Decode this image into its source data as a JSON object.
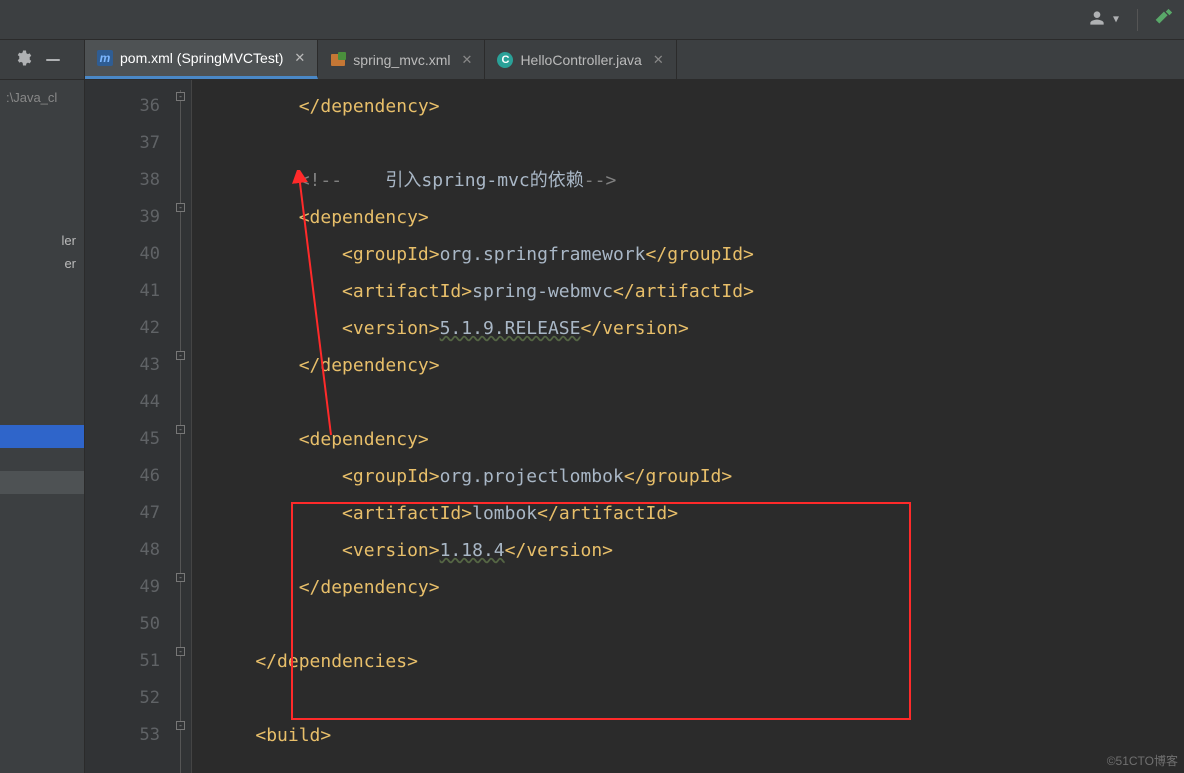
{
  "topbar": {},
  "sidebar": {
    "path": ":\\Java_cl",
    "item1": "ler",
    "item2": "er"
  },
  "tabs": {
    "t1": "pom.xml (SpringMVCTest)",
    "t2": "spring_mvc.xml",
    "t3": "HelloController.java"
  },
  "gutter": [
    "36",
    "37",
    "38",
    "39",
    "40",
    "41",
    "42",
    "43",
    "44",
    "45",
    "46",
    "47",
    "48",
    "49",
    "50",
    "51",
    "52",
    "53"
  ],
  "code": {
    "l36a": "        </",
    "l36b": "dependency",
    "l36c": ">",
    "l37": "",
    "l38a": "        <!--    ",
    "l38b": "引入spring-mvc的依赖",
    "l38c": "-->",
    "l39a": "        <",
    "l39b": "dependency",
    "l39c": ">",
    "l40a": "            <",
    "l40b": "groupId",
    "l40c": ">",
    "l40d": "org.springframework",
    "l40e": "</",
    "l40f": "groupId",
    "l40g": ">",
    "l41a": "            <",
    "l41b": "artifactId",
    "l41c": ">",
    "l41d": "spring-webmvc",
    "l41e": "</",
    "l41f": "artifactId",
    "l41g": ">",
    "l42a": "            <",
    "l42b": "version",
    "l42c": ">",
    "l42d": "5.1.9.RELEASE",
    "l42e": "</",
    "l42f": "version",
    "l42g": ">",
    "l43a": "        </",
    "l43b": "dependency",
    "l43c": ">",
    "l44": "",
    "l45a": "        <",
    "l45b": "dependency",
    "l45c": ">",
    "l46a": "            <",
    "l46b": "groupId",
    "l46c": ">",
    "l46d": "org.projectlombok",
    "l46e": "</",
    "l46f": "groupId",
    "l46g": ">",
    "l47a": "            <",
    "l47b": "artifactId",
    "l47c": ">",
    "l47d": "lombok",
    "l47e": "</",
    "l47f": "artifactId",
    "l47g": ">",
    "l48a": "            <",
    "l48b": "version",
    "l48c": ">",
    "l48d": "1.18.4",
    "l48e": "</",
    "l48f": "version",
    "l48g": ">",
    "l49a": "        </",
    "l49b": "dependency",
    "l49c": ">",
    "l50": "",
    "l51a": "    </",
    "l51b": "dependencies",
    "l51c": ">",
    "l52": "",
    "l53a": "    <",
    "l53b": "build",
    "l53c": ">"
  },
  "icons": {
    "m": "m",
    "c": "C"
  },
  "watermark": "©51CTO博客"
}
